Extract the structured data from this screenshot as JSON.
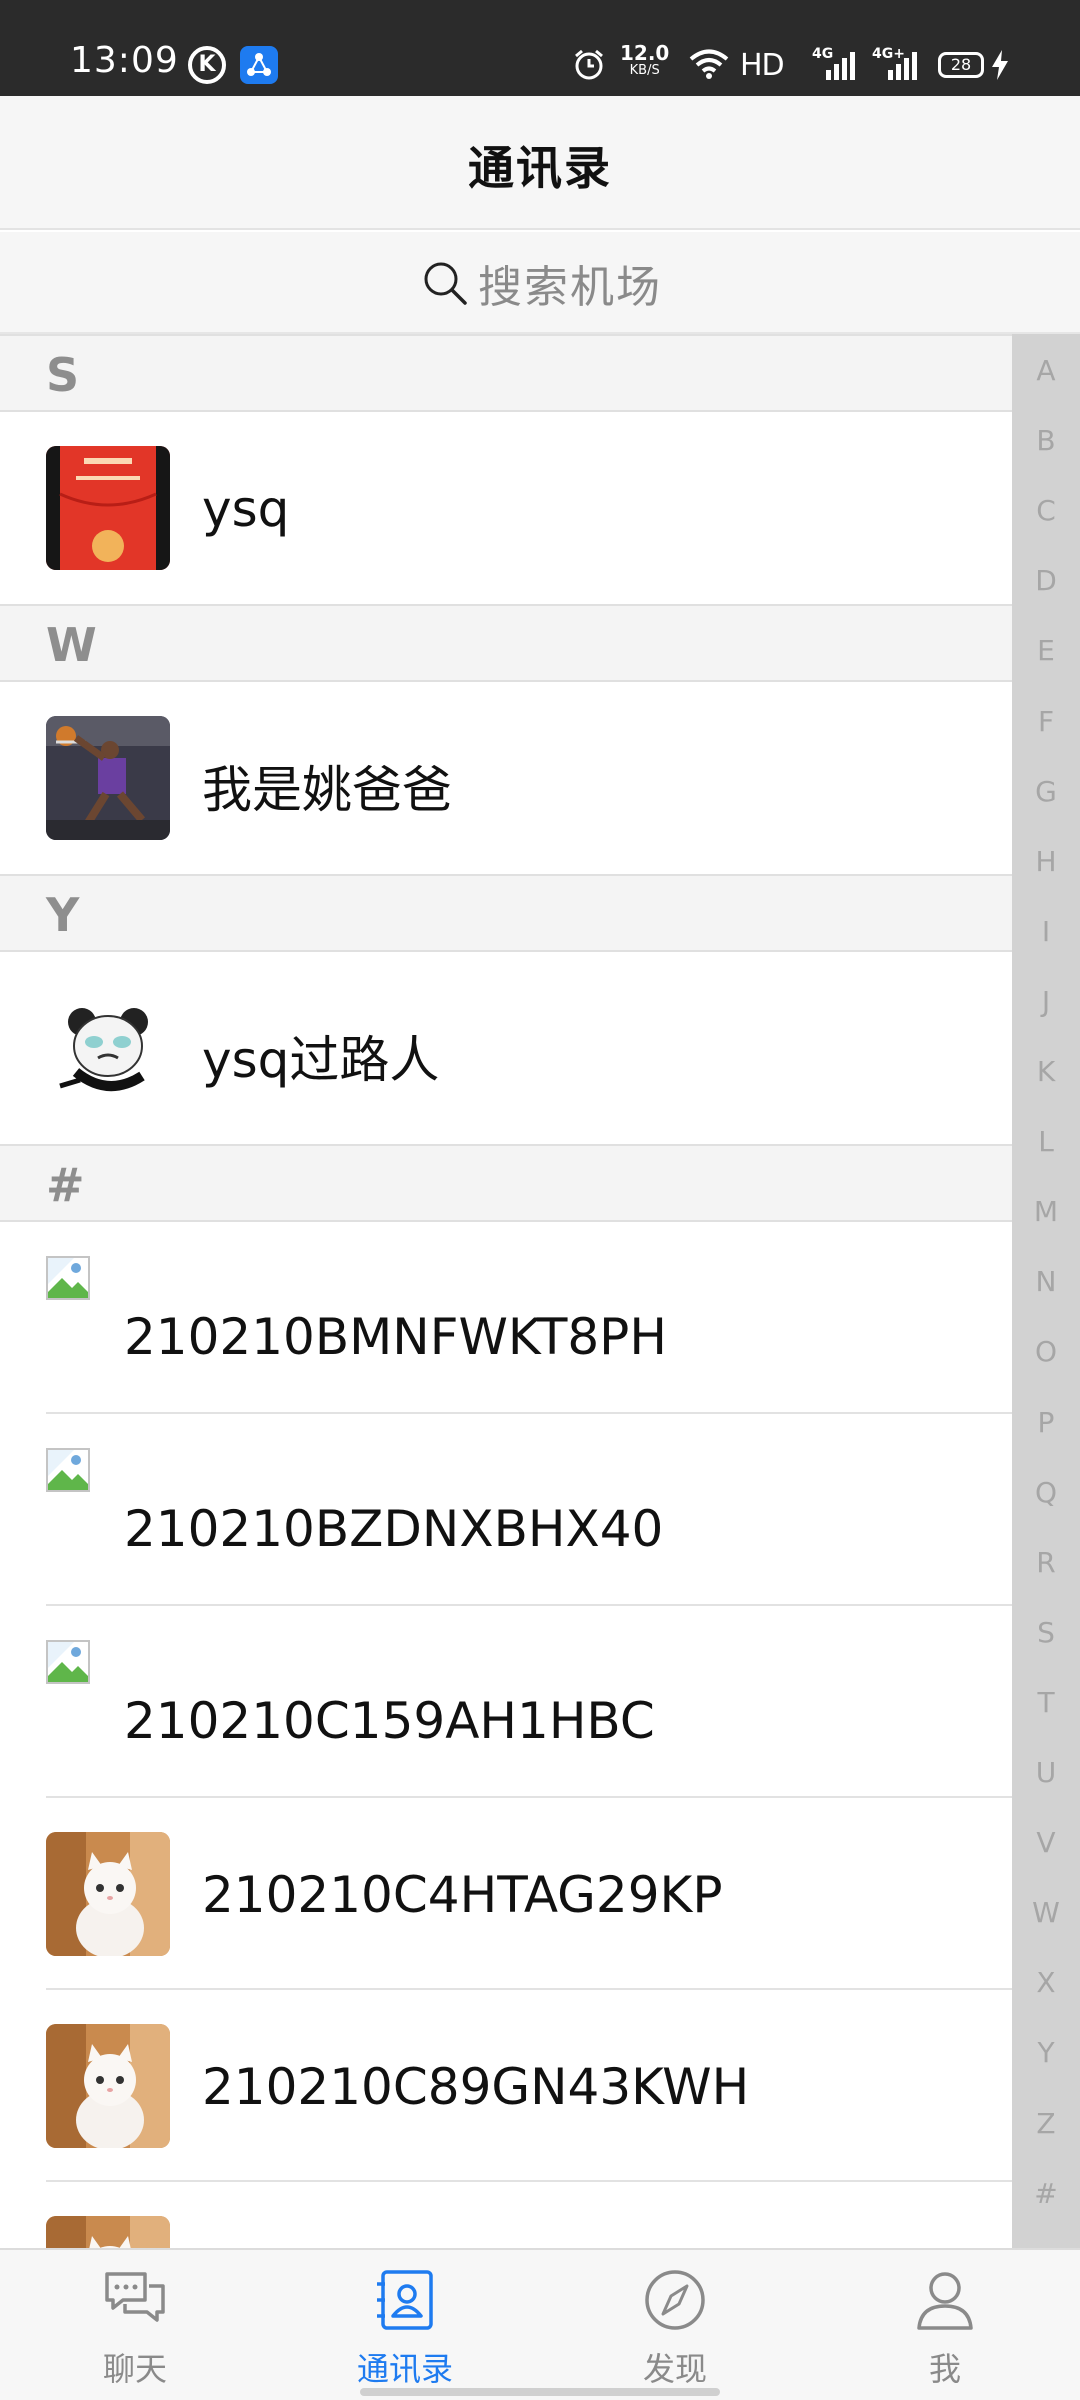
{
  "status_bar": {
    "time": "13:09",
    "net_speed": "12.0",
    "net_unit": "KB/S",
    "hd": "HD",
    "network_1": "4G",
    "network_2": "4G+",
    "battery": "28"
  },
  "header": {
    "title": "通讯录"
  },
  "search": {
    "placeholder": "搜索机场"
  },
  "sections": [
    {
      "letter": "S",
      "contacts": [
        {
          "name": "ysq",
          "avatar": "red-envelope-avatar"
        }
      ]
    },
    {
      "letter": "W",
      "contacts": [
        {
          "name": "我是姚爸爸",
          "avatar": "basketball-dunk-avatar"
        }
      ]
    },
    {
      "letter": "Y",
      "contacts": [
        {
          "name": "ysq过路人",
          "avatar": "panda-meme-avatar"
        }
      ]
    },
    {
      "letter": "#",
      "contacts": [
        {
          "name": "210210BMNFWKT8PH",
          "avatar": "broken-image-icon"
        },
        {
          "name": "210210BZDNXBHX40",
          "avatar": "broken-image-icon"
        },
        {
          "name": "210210C159AH1HBC",
          "avatar": "broken-image-icon"
        },
        {
          "name": "210210C4HTAG29KP",
          "avatar": "white-cat-avatar"
        },
        {
          "name": "210210C89GN43KWH",
          "avatar": "white-cat-avatar"
        }
      ]
    }
  ],
  "index_letters": [
    "A",
    "B",
    "C",
    "D",
    "E",
    "F",
    "G",
    "H",
    "I",
    "J",
    "K",
    "L",
    "M",
    "N",
    "O",
    "P",
    "Q",
    "R",
    "S",
    "T",
    "U",
    "V",
    "W",
    "X",
    "Y",
    "Z",
    "#"
  ],
  "bottom_nav": [
    {
      "label": "聊天",
      "icon": "chat-icon",
      "active": false
    },
    {
      "label": "通讯录",
      "icon": "contacts-icon",
      "active": true
    },
    {
      "label": "发现",
      "icon": "compass-icon",
      "active": false
    },
    {
      "label": "我",
      "icon": "person-icon",
      "active": false
    }
  ],
  "colors": {
    "accent": "#1e7bf0",
    "status_bar": "#2b2b2b",
    "index_bar": "#d2d2d2"
  }
}
